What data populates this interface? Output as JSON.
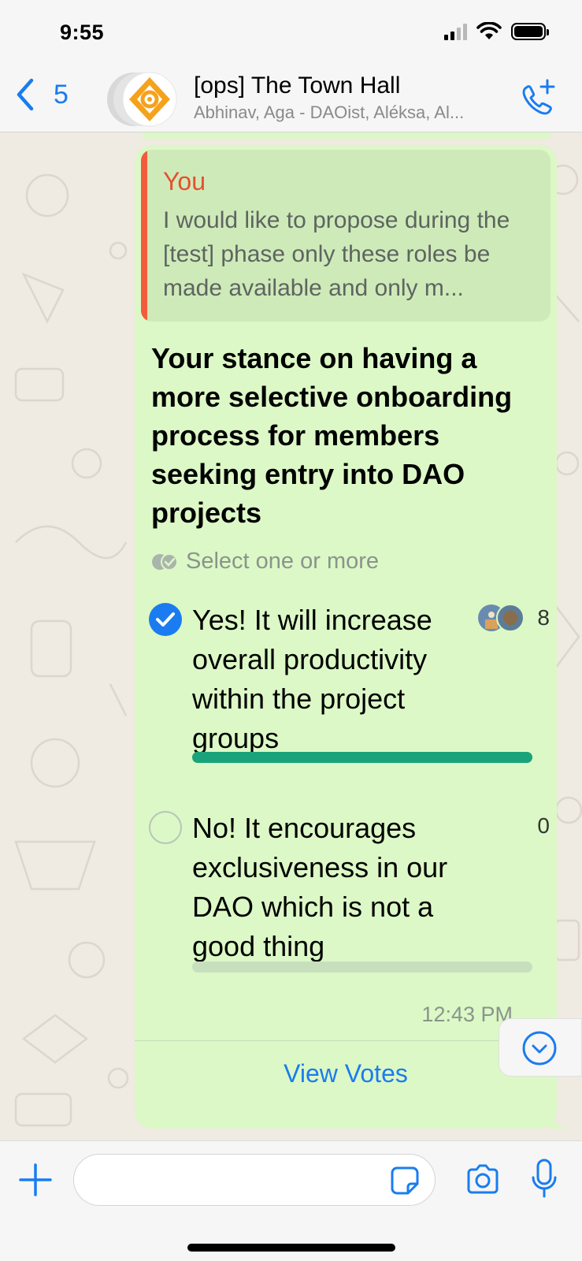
{
  "status_bar": {
    "time": "9:55"
  },
  "header": {
    "back_count": "5",
    "title": "[ops] The Town Hall",
    "subtitle": "Abhinav, Aga - DAOist, Aléksa, Al..."
  },
  "message": {
    "quote": {
      "sender": "You",
      "text": "I would like to propose during the [test] phase only these roles be made available and only m..."
    },
    "poll": {
      "question": "Your stance on having a more selective onboarding process for members seeking entry into DAO projects",
      "hint": "Select one or more",
      "options": [
        {
          "label": "Yes! It will increase overall productivity within the project groups",
          "count": "8",
          "selected": true,
          "fraction": 1.0
        },
        {
          "label": "No! It encourages exclusiveness in our DAO which is not a good thing",
          "count": "0",
          "selected": false,
          "fraction": 0.0
        }
      ]
    },
    "time": "12:43 PM",
    "view_votes": "View Votes"
  },
  "input": {
    "placeholder": ""
  },
  "colors": {
    "accent": "#1a7cf0",
    "bubble": "#dcf8c6",
    "quote_bar": "#f25c3c",
    "vote_bar": "#1aa37a"
  }
}
